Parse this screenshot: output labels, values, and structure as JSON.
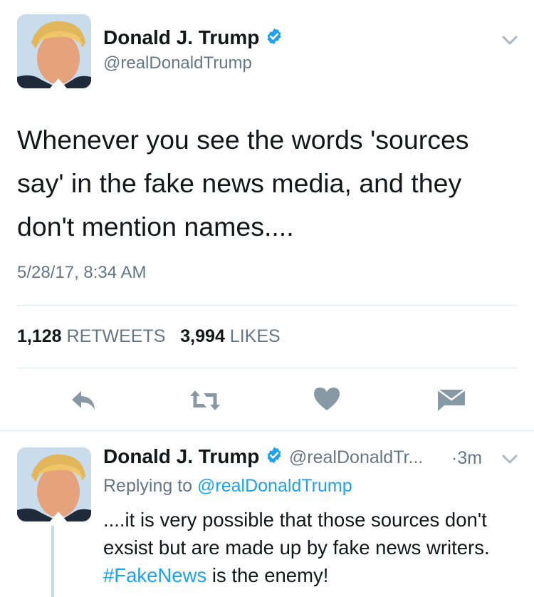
{
  "main_tweet": {
    "author_name": "Donald J. Trump",
    "handle": "@realDonaldTrump",
    "text": "Whenever you see the words 'sources say' in the fake news media, and they don't mention names....",
    "timestamp": "5/28/17, 8:34 AM",
    "retweet_count": "1,128",
    "retweet_label": "RETWEETS",
    "like_count": "3,994",
    "like_label": "LIKES"
  },
  "actions": [
    {
      "icon": "reply-icon"
    },
    {
      "icon": "retweet-icon"
    },
    {
      "icon": "like-icon"
    },
    {
      "icon": "direct-message-icon"
    }
  ],
  "reply_tweet": {
    "author_name": "Donald J. Trump",
    "handle": "@realDonaldTr...",
    "age": "3m",
    "replying_label": "Replying to",
    "replying_handle": "@realDonaldTrump",
    "text_before": "....it is very possible that those sources don't exsist but are made up by fake news writers. ",
    "hashtag": "#FakeNews",
    "text_after": " is the enemy!"
  },
  "colors": {
    "accent": "#1da1f2",
    "muted": "#657786",
    "icon": "#8899a6",
    "divider": "#e1e8ed"
  }
}
